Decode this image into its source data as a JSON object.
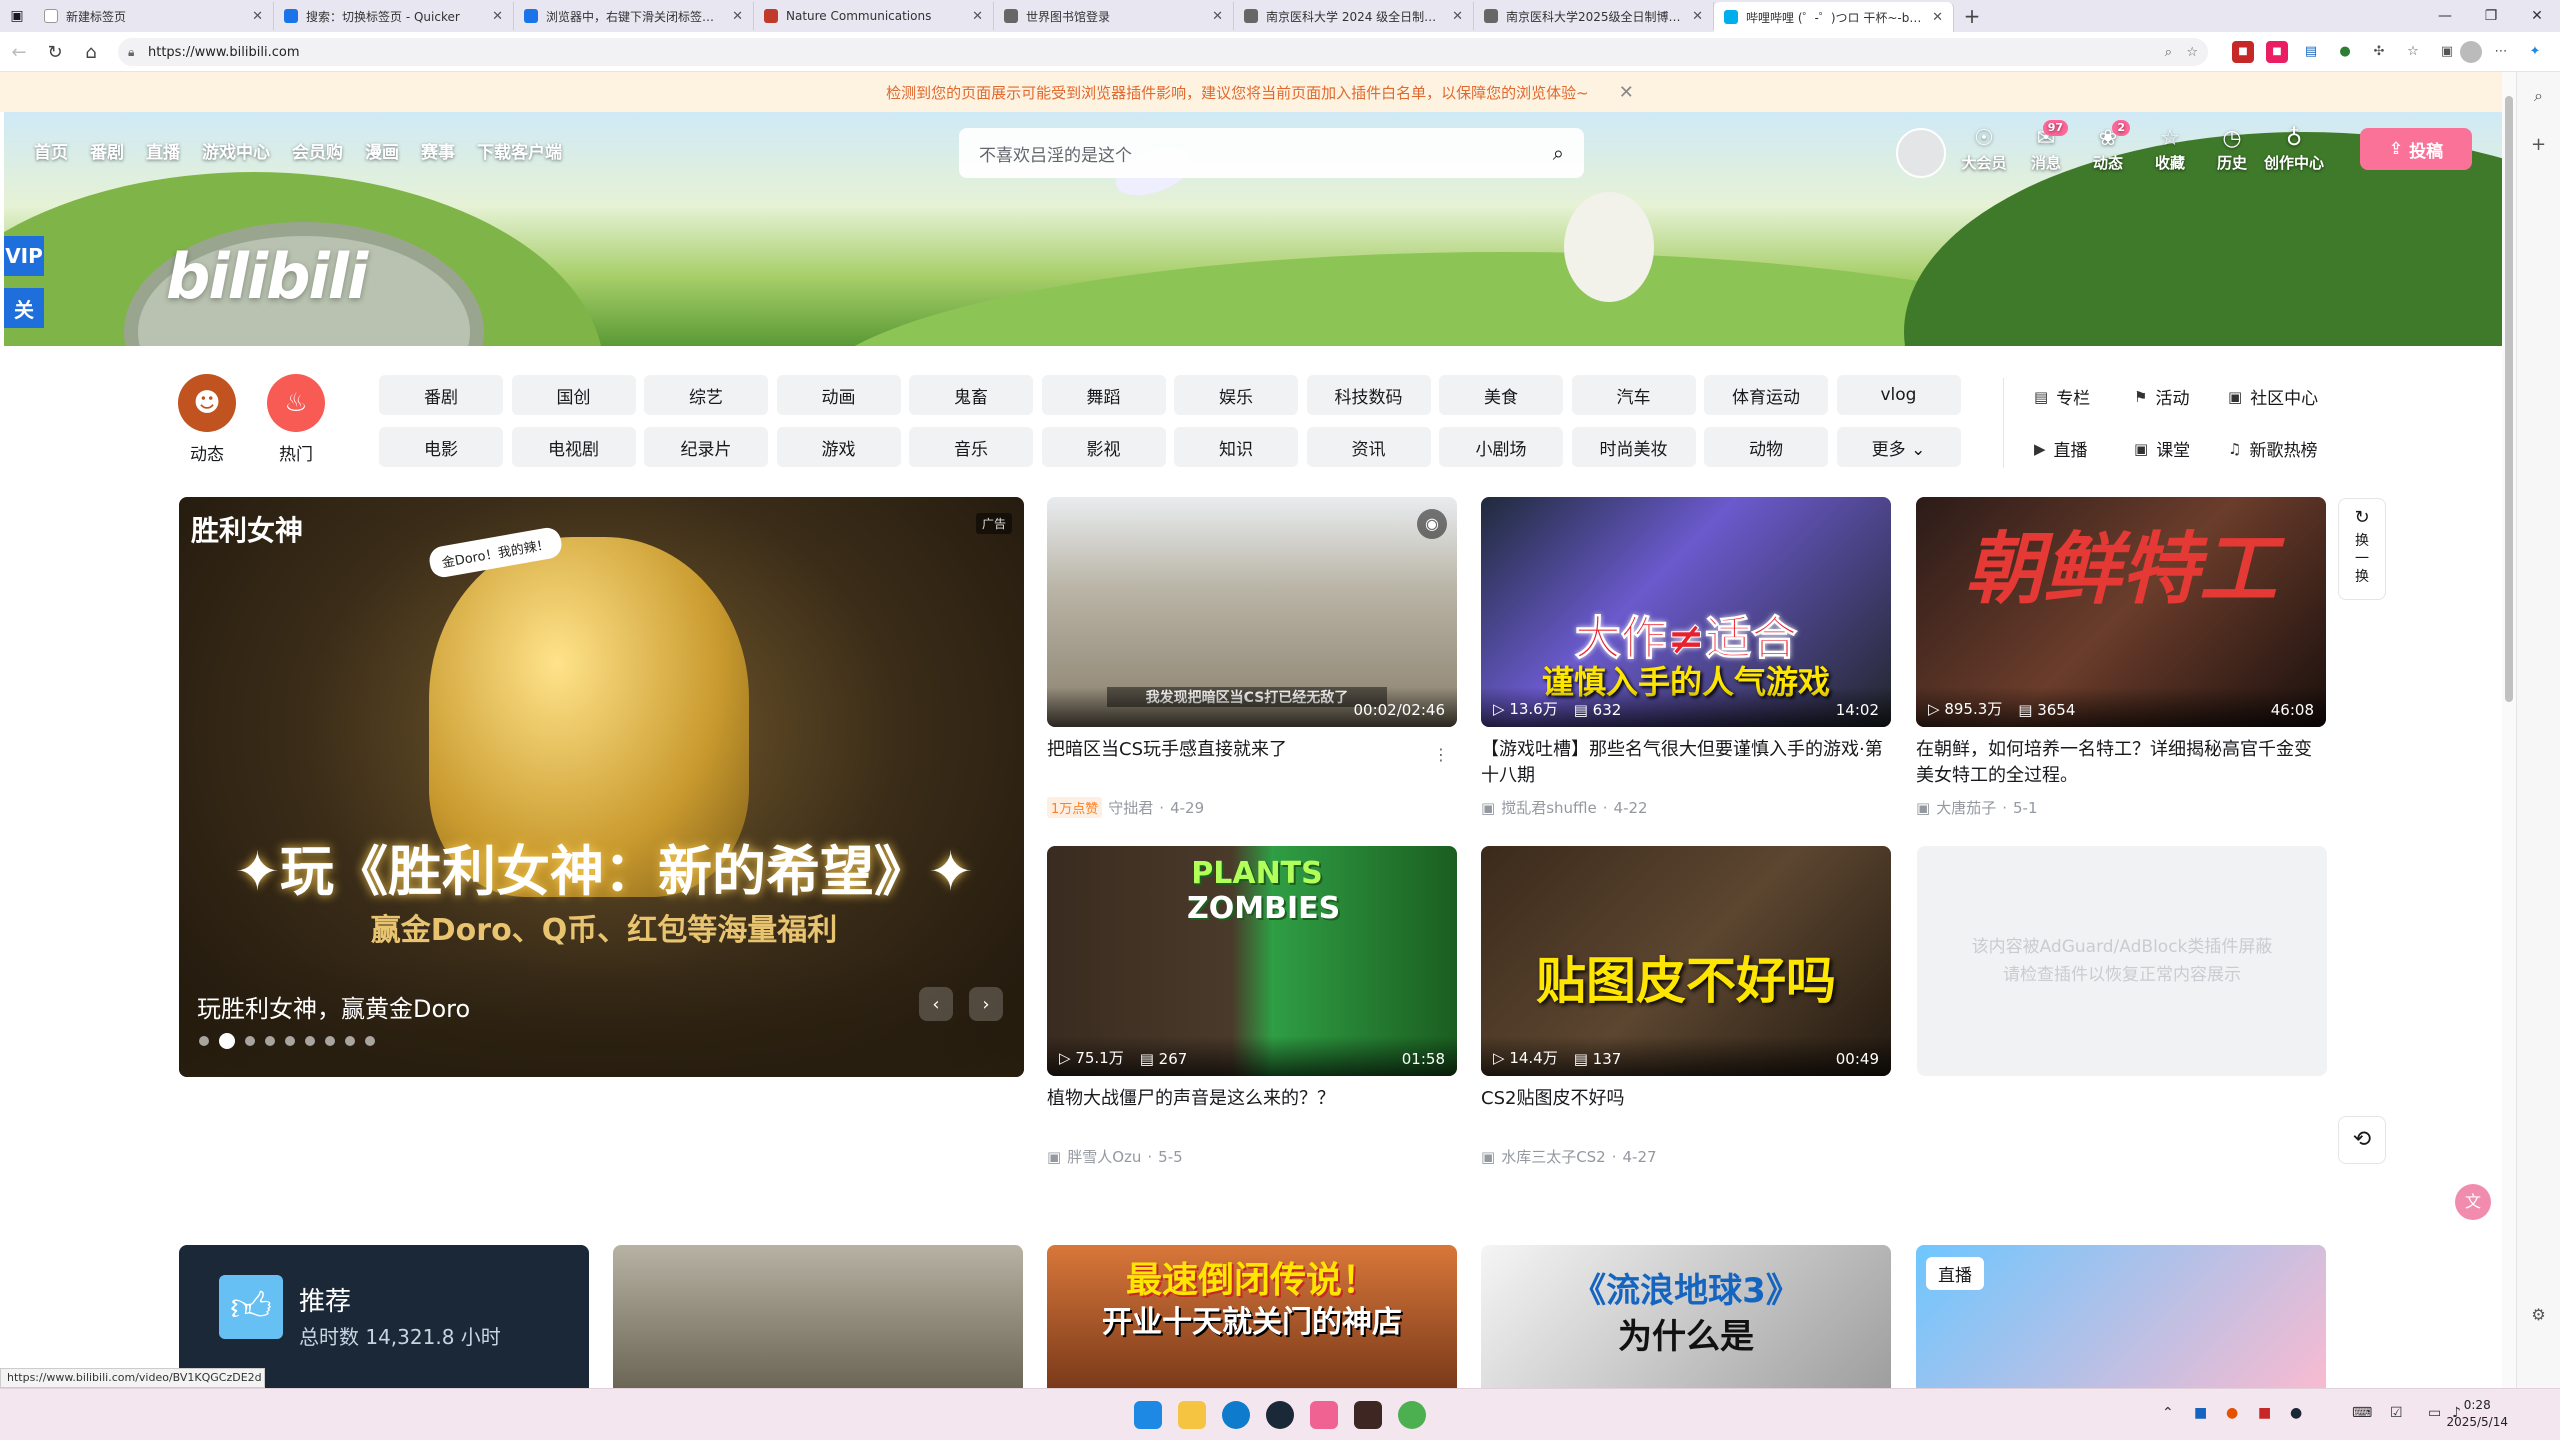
{
  "browser": {
    "tabs": [
      {
        "title": "新建标签页",
        "color": "#ffffff"
      },
      {
        "title": "搜索：切换标签页 - Quicker",
        "color": "#1a73e8"
      },
      {
        "title": "浏览器中，右键下滑关闭标签页…",
        "color": "#1a73e8"
      },
      {
        "title": "Nature Communications",
        "color": "#c0392b"
      },
      {
        "title": "世界图书馆登录",
        "color": "#666666"
      },
      {
        "title": "南京医科大学 2024 级全日制博士…",
        "color": "#666666"
      },
      {
        "title": "南京医科大学2025级全日制博士…",
        "color": "#666666"
      },
      {
        "title": "哔哩哔哩 (゜-゜)つロ 干杯~-bilib…",
        "color": "#00aeec"
      }
    ],
    "new_tab": "+",
    "url": "https://www.bilibili.com",
    "status_url": "https://www.bilibili.com/video/BV1KQGCzDE2d"
  },
  "notice": {
    "text": "检测到您的页面展示可能受到浏览器插件影响，建议您将当前页面加入插件白名单，以保障您的浏览体验~",
    "close": "✕"
  },
  "header": {
    "nav": [
      "首页",
      "番剧",
      "直播",
      "游戏中心",
      "会员购",
      "漫画",
      "赛事",
      "下载客户端"
    ],
    "search_placeholder": "不喜欢吕淫的是这个",
    "logo": "bilibili",
    "right_nav": [
      {
        "label": "大会员",
        "icon": "☉",
        "badge": ""
      },
      {
        "label": "消息",
        "icon": "✉",
        "badge": "97"
      },
      {
        "label": "动态",
        "icon": "❀",
        "badge": "2"
      },
      {
        "label": "收藏",
        "icon": "☆",
        "badge": ""
      },
      {
        "label": "历史",
        "icon": "◷",
        "badge": ""
      },
      {
        "label": "创作中心",
        "icon": "♁",
        "badge": ""
      }
    ],
    "upload": "投稿",
    "vip_badge": "VIP",
    "guan_badge": "关"
  },
  "channels": {
    "quick": [
      {
        "label": "动态"
      },
      {
        "label": "热门"
      }
    ],
    "row1": [
      "番剧",
      "国创",
      "综艺",
      "动画",
      "鬼畜",
      "舞蹈",
      "娱乐",
      "科技数码",
      "美食",
      "汽车",
      "体育运动",
      "vlog"
    ],
    "row2": [
      "电影",
      "电视剧",
      "纪录片",
      "游戏",
      "音乐",
      "影视",
      "知识",
      "资讯",
      "小剧场",
      "时尚美妆",
      "动物",
      "更多 ⌄"
    ],
    "side": [
      "专栏",
      "活动",
      "社区中心",
      "直播",
      "课堂",
      "新歌热榜"
    ]
  },
  "carousel": {
    "caption": "玩胜利女神，赢黄金Doro",
    "ad": "广告",
    "art_title": "✦玩《胜利女神：新的希望》✦",
    "art_sub": "赢金Doro、Q币、红包等海量福利",
    "brand": "胜利女神",
    "speech": "金Doro！我的辣！",
    "slides": 9,
    "active": 1
  },
  "videos": [
    {
      "title": "把暗区当CS玩手感直接就来了",
      "author": "守拙君",
      "date": "4-29",
      "hot": "1万点赞",
      "duration": "00:02/02:46",
      "views": "",
      "comments": "",
      "subtitle": "我发现把暗区当CS打已经无敌了"
    },
    {
      "title": "【游戏吐槽】那些名气很大但要谨慎入手的游戏·第十八期",
      "author": "搅乱君shuffle",
      "date": "4-22",
      "hot": "",
      "duration": "14:02",
      "views": "13.6万",
      "comments": "632",
      "art1": "大作≠适合",
      "art2": "谨慎入手的人气游戏"
    },
    {
      "title": "在朝鲜，如何培养一名特工？详细揭秘高官千金变美女特工的全过程。",
      "author": "大唐茄子",
      "date": "5-1",
      "hot": "",
      "duration": "46:08",
      "views": "895.3万",
      "comments": "3654",
      "art1": "朝鲜特工"
    },
    {
      "title": "植物大战僵尸的声音是这么来的？？",
      "author": "胖雪人Ozu",
      "date": "5-5",
      "hot": "",
      "duration": "01:58",
      "views": "75.1万",
      "comments": "267",
      "art1": "PLANTS",
      "art2": "ZOMBIES"
    },
    {
      "title": "CS2贴图皮不好吗",
      "author": "水库三太子CS2",
      "date": "4-27",
      "hot": "",
      "duration": "00:49",
      "views": "14.4万",
      "comments": "137",
      "art1": "贴图皮不好吗"
    }
  ],
  "blocked": {
    "line1": "该内容被AdGuard/AdBlock类插件屏蔽",
    "line2": "请检查插件以恢复正常内容展示"
  },
  "refresh": {
    "label": "换一换"
  },
  "bottom_row": [
    {
      "text1": "推荐",
      "text2": "总时数 14,321.8 小时"
    },
    {
      "text1": ""
    },
    {
      "text1": "最速倒闭传说！",
      "text2": "开业十天就关门的神店"
    },
    {
      "text1": "《流浪地球3》",
      "text2": "为什么是"
    },
    {
      "text1": "直播"
    }
  ],
  "clock": {
    "time": "0:28",
    "date": "2025/5/14"
  }
}
